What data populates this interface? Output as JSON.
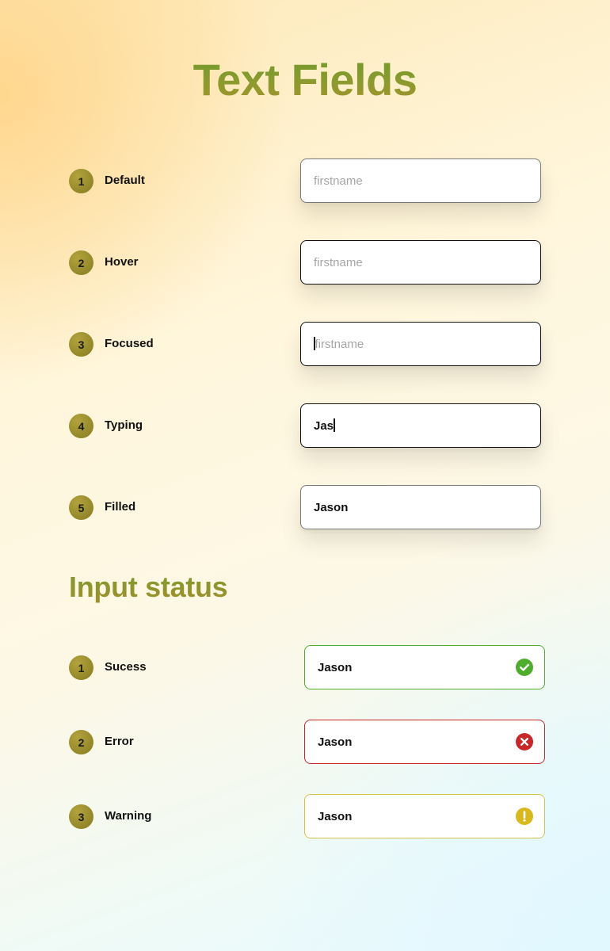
{
  "title": "Text Fields",
  "fields": [
    {
      "number": "1",
      "label": "Default",
      "placeholder": "firstname",
      "value": "",
      "state": "default"
    },
    {
      "number": "2",
      "label": "Hover",
      "placeholder": "firstname",
      "value": "",
      "state": "hover"
    },
    {
      "number": "3",
      "label": "Focused",
      "placeholder": "firstname",
      "value": "",
      "state": "focused"
    },
    {
      "number": "4",
      "label": "Typing",
      "placeholder": "",
      "value": "Jas",
      "state": "typing"
    },
    {
      "number": "5",
      "label": "Filled",
      "placeholder": "",
      "value": "Jason",
      "state": "filled"
    }
  ],
  "status_section": {
    "title": "Input status",
    "items": [
      {
        "number": "1",
        "label": "Sucess",
        "value": "Jason",
        "status": "success",
        "icon": "check-circle-icon",
        "color": "#4eae2c"
      },
      {
        "number": "2",
        "label": "Error",
        "value": "Jason",
        "status": "error",
        "icon": "x-circle-icon",
        "color": "#c8282a"
      },
      {
        "number": "3",
        "label": "Warning",
        "value": "Jason",
        "status": "warning",
        "icon": "exclamation-circle-icon",
        "color": "#d8b81c"
      }
    ]
  }
}
